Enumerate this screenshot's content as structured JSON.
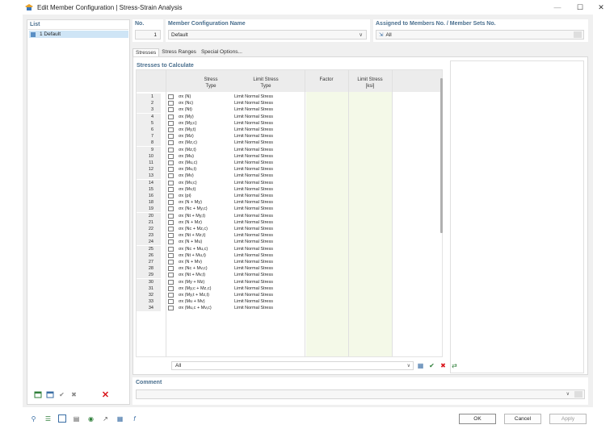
{
  "window": {
    "title": "Edit Member Configuration | Stress-Strain Analysis",
    "icon": "app-hat-icon"
  },
  "list": {
    "header": "List",
    "items": [
      {
        "label": "1  Default",
        "selected": true
      }
    ]
  },
  "header": {
    "no_label": "No.",
    "no_value": "1",
    "name_label": "Member Configuration Name",
    "name_value": "Default",
    "assigned_label": "Assigned to Members No. / Member Sets No.",
    "assigned_value": "All"
  },
  "tabs": [
    {
      "label": "Stresses",
      "active": true
    },
    {
      "label": "Stress Ranges",
      "active": false
    },
    {
      "label": "Special Options...",
      "active": false
    }
  ],
  "stresses": {
    "title": "Stresses to Calculate",
    "columns": {
      "stress_type": [
        "Stress",
        "Type"
      ],
      "limit_type": [
        "Limit Stress",
        "Type"
      ],
      "factor": [
        "",
        "Factor"
      ],
      "limit_value": [
        "Limit Stress",
        "[ksi]"
      ]
    },
    "rows": [
      {
        "no": "1",
        "stress": "σx (N)",
        "limit": "Limit Normal Stress"
      },
      {
        "no": "2",
        "stress": "σx (Nc)",
        "limit": "Limit Normal Stress"
      },
      {
        "no": "3",
        "stress": "σx (Nt)",
        "limit": "Limit Normal Stress"
      },
      {
        "no": "4",
        "stress": "σx (My)",
        "limit": "Limit Normal Stress"
      },
      {
        "no": "5",
        "stress": "σx (My,c)",
        "limit": "Limit Normal Stress"
      },
      {
        "no": "6",
        "stress": "σx (My,t)",
        "limit": "Limit Normal Stress"
      },
      {
        "no": "7",
        "stress": "σx (Mz)",
        "limit": "Limit Normal Stress"
      },
      {
        "no": "8",
        "stress": "σx (Mz,c)",
        "limit": "Limit Normal Stress"
      },
      {
        "no": "9",
        "stress": "σx (Mz,t)",
        "limit": "Limit Normal Stress"
      },
      {
        "no": "10",
        "stress": "σx (Mu)",
        "limit": "Limit Normal Stress"
      },
      {
        "no": "11",
        "stress": "σx (Mu,c)",
        "limit": "Limit Normal Stress"
      },
      {
        "no": "12",
        "stress": "σx (Mu,t)",
        "limit": "Limit Normal Stress"
      },
      {
        "no": "13",
        "stress": "σx (Mv)",
        "limit": "Limit Normal Stress"
      },
      {
        "no": "14",
        "stress": "σx (Mv,c)",
        "limit": "Limit Normal Stress"
      },
      {
        "no": "15",
        "stress": "σx (Mv,t)",
        "limit": "Limit Normal Stress"
      },
      {
        "no": "16",
        "stress": "σx (pi)",
        "limit": "Limit Normal Stress"
      },
      {
        "no": "18",
        "stress": "σx (N + My)",
        "limit": "Limit Normal Stress"
      },
      {
        "no": "19",
        "stress": "σx (Nc + My,c)",
        "limit": "Limit Normal Stress"
      },
      {
        "no": "20",
        "stress": "σx (Nt + My,t)",
        "limit": "Limit Normal Stress"
      },
      {
        "no": "21",
        "stress": "σx (N + Mz)",
        "limit": "Limit Normal Stress"
      },
      {
        "no": "22",
        "stress": "σx (Nc + Mz,c)",
        "limit": "Limit Normal Stress"
      },
      {
        "no": "23",
        "stress": "σx (Nt + Mz,t)",
        "limit": "Limit Normal Stress"
      },
      {
        "no": "24",
        "stress": "σx (N + Mu)",
        "limit": "Limit Normal Stress"
      },
      {
        "no": "25",
        "stress": "σx (Nc + Mu,c)",
        "limit": "Limit Normal Stress"
      },
      {
        "no": "26",
        "stress": "σx (Nt + Mu,t)",
        "limit": "Limit Normal Stress"
      },
      {
        "no": "27",
        "stress": "σx (N + Mv)",
        "limit": "Limit Normal Stress"
      },
      {
        "no": "28",
        "stress": "σx (Nc + Mv,c)",
        "limit": "Limit Normal Stress"
      },
      {
        "no": "29",
        "stress": "σx (Nt + Mv,t)",
        "limit": "Limit Normal Stress"
      },
      {
        "no": "30",
        "stress": "σx (My + Mz)",
        "limit": "Limit Normal Stress"
      },
      {
        "no": "31",
        "stress": "σx (My,c + Mz,c)",
        "limit": "Limit Normal Stress"
      },
      {
        "no": "32",
        "stress": "σx (My,t + Mz,t)",
        "limit": "Limit Normal Stress"
      },
      {
        "no": "33",
        "stress": "σx (Mu + Mv)",
        "limit": "Limit Normal Stress"
      },
      {
        "no": "34",
        "stress": "σx (Mu,c + Mv,c)",
        "limit": "Limit Normal Stress"
      }
    ],
    "filter_value": "All"
  },
  "comment": {
    "label": "Comment",
    "value": ""
  },
  "buttons": {
    "ok": "OK",
    "cancel": "Cancel",
    "apply": "Apply"
  },
  "colors": {
    "header_blue": "#4a6f8e",
    "selection": "#cfe5f6",
    "factor_column": "#f4f9e8",
    "delete_red": "#d9161c"
  }
}
